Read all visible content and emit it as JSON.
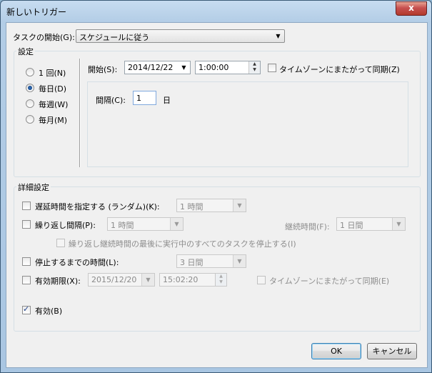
{
  "window": {
    "title": "新しいトリガー",
    "close_glyph": "x"
  },
  "begin_task": {
    "label": "タスクの開始(G):",
    "value": "スケジュールに従う"
  },
  "settings": {
    "group_label": "設定",
    "radios": [
      {
        "label": "1 回(N)"
      },
      {
        "label": "毎日(D)"
      },
      {
        "label": "毎週(W)"
      },
      {
        "label": "毎月(M)"
      }
    ],
    "selected": "毎日(D)",
    "start_label": "開始(S):",
    "start_date": "2014/12/22",
    "start_time": "1:00:00",
    "sync_tz_label": "タイムゾーンにまたがって同期(Z)",
    "interval_label": "間隔(C):",
    "interval_value": "1",
    "interval_unit": "日"
  },
  "advanced": {
    "group_label": "詳細設定",
    "delay_label": "遅延時間を指定する (ランダム)(K):",
    "delay_value": "1 時間",
    "repeat_label": "繰り返し間隔(P):",
    "repeat_value": "1 時間",
    "duration_label": "継続時間(F):",
    "duration_value": "1 日間",
    "stop_all_label": "繰り返し継続時間の最後に実行中のすべてのタスクを停止する(I)",
    "stop_after_label": "停止するまでの時間(L):",
    "stop_after_value": "3 日間",
    "expire_label": "有効期限(X):",
    "expire_date": "2015/12/20",
    "expire_time": "15:02:20",
    "expire_sync_label": "タイムゾーンにまたがって同期(E)",
    "enabled_label": "有効(B)"
  },
  "buttons": {
    "ok": "OK",
    "cancel": "キャンセル"
  }
}
